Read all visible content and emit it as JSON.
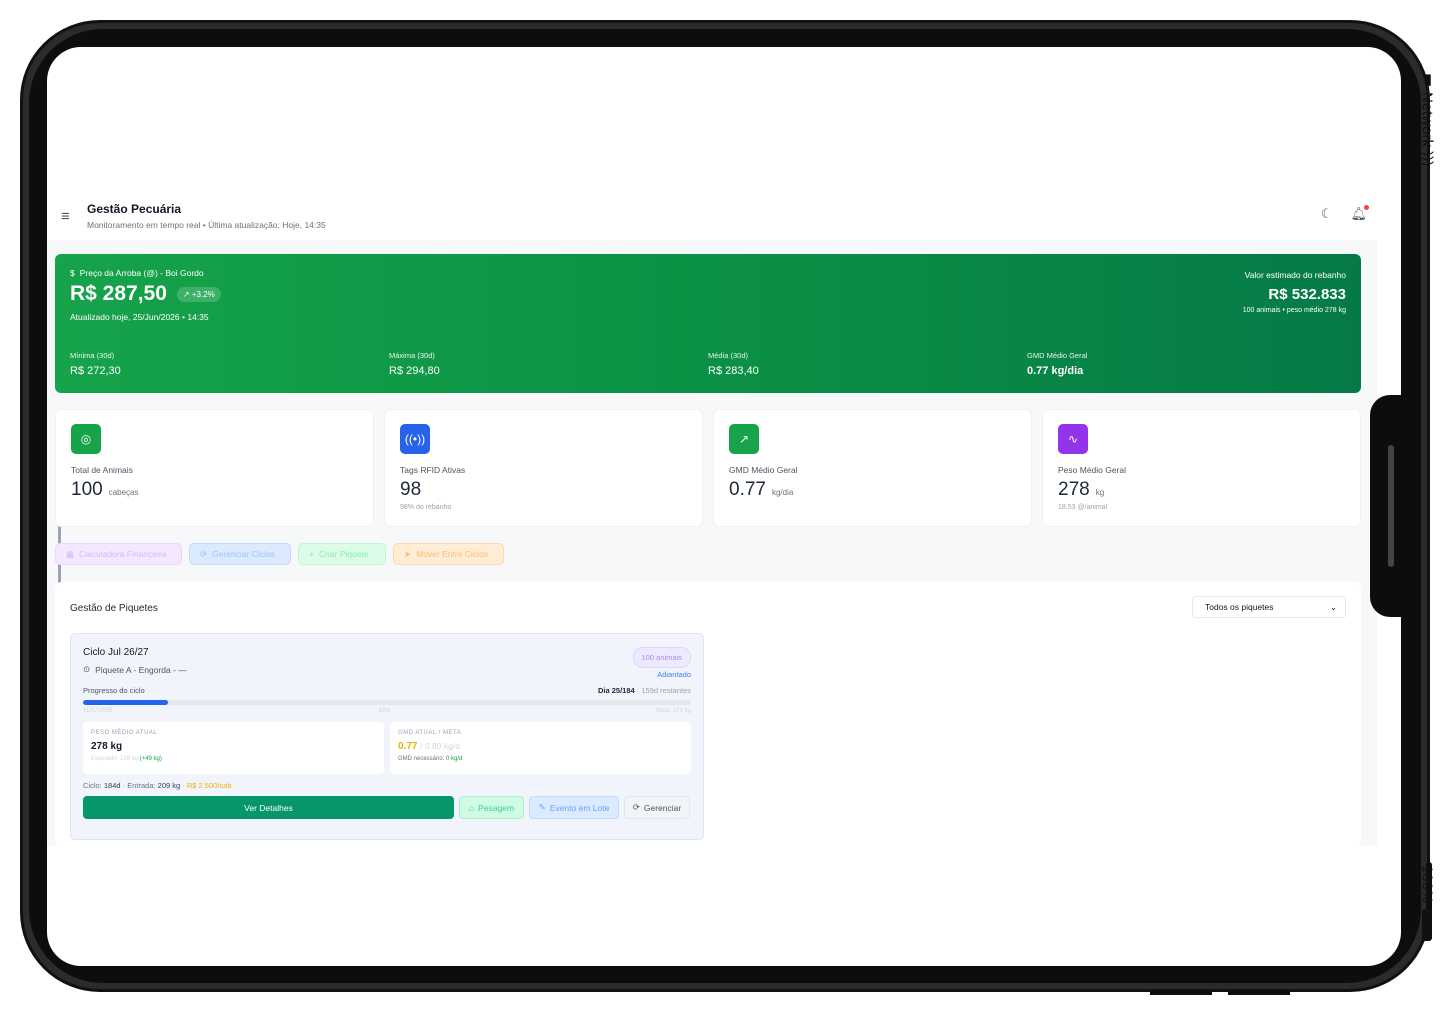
{
  "device": {
    "network_label": "Network",
    "battery_label": "100%"
  },
  "header": {
    "title": "Gestão Pecuária",
    "subtitle": "Monitoramento em tempo real • Última atualização: Hoje, 14:35"
  },
  "price_banner": {
    "label": "Preço da Arroba (@) - Boi Gordo",
    "price": "R$ 287,50",
    "change": "+3.2%",
    "updated": "Atualizado hoje, 25/Jun/2026 • 14:35",
    "herd_value_label": "Valor estimado do rebanho",
    "herd_value": "R$ 532.833",
    "herd_value_sub": "100 animais • peso médio 278 kg",
    "stats": [
      {
        "label": "Mínima (30d)",
        "value": "R$ 272,30"
      },
      {
        "label": "Máxima (30d)",
        "value": "R$ 294,80"
      },
      {
        "label": "Média (30d)",
        "value": "R$ 283,40"
      },
      {
        "label": "GMD Médio Geral",
        "value": "0.77 kg/dia"
      }
    ]
  },
  "cards": [
    {
      "label": "Total de Animais",
      "value": "100",
      "unit": "cabeças",
      "sub": "",
      "icon": "cattle-icon",
      "color": "#16a34a"
    },
    {
      "label": "Tags RFID Ativas",
      "value": "98",
      "unit": "",
      "sub": "98% do rebanho",
      "icon": "rfid-icon",
      "color": "#2563eb"
    },
    {
      "label": "GMD Médio Geral",
      "value": "0.77",
      "unit": "kg/dia",
      "sub": "",
      "icon": "trending-up-icon",
      "color": "#16a34a"
    },
    {
      "label": "Peso Médio Geral",
      "value": "278",
      "unit": "kg",
      "sub": "18.53 @/animal",
      "icon": "activity-icon",
      "color": "#9333ea"
    }
  ],
  "quick_actions": [
    {
      "label": "Calculadora Financeira",
      "icon": "calculator-icon"
    },
    {
      "label": "Gerenciar Ciclos",
      "icon": "refresh-icon"
    },
    {
      "label": "Criar Piquete",
      "icon": "plus-icon"
    },
    {
      "label": "Mover Entre Ciclos",
      "icon": "send-icon"
    }
  ],
  "piquetes": {
    "title": "Gestão de Piquetes",
    "filter_value": "Todos os piquetes",
    "cycle": {
      "title": "Ciclo Jul 26/27",
      "location": "Piquete A - Engorda - —",
      "badge": "100 animais",
      "status": "Adiantado",
      "progress_label": "Progresso do ciclo",
      "progress_day": "Dia 25/184",
      "progress_remaining": "· 159d restantes",
      "progress": 0.14,
      "bar_start": "11/07/2026",
      "bar_pct": "14%",
      "bar_goal": "Meta: 270 kg",
      "weight_label": "PESO MÉDIO ATUAL",
      "weight_value": "278 kg",
      "weight_expected": "Esperado: 228 kg",
      "weight_diff": "(+49 kg)",
      "gmd_label": "GMD ATUAL / META",
      "gmd_value": "0.77",
      "gmd_goal": "/ 0.80 kg/d",
      "gmd_needed_label": "GMD necessário:",
      "gmd_needed": "0 kg/d",
      "meta_cycle_label": "Ciclo:",
      "meta_cycle": "184d",
      "meta_entry_label": "· Entrada:",
      "meta_entry": "209 kg",
      "meta_price": "· R$ 2.500/cab",
      "actions": {
        "details": "Ver Detalhes",
        "weighing": "Pesagem",
        "batch_event": "Evento em Lote",
        "manage": "Gerenciar"
      }
    }
  }
}
